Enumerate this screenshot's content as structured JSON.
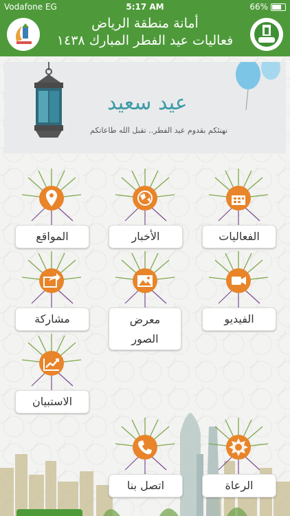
{
  "status_bar": {
    "carrier": "Vodafone EG",
    "time": "5:17 AM",
    "battery": "66%"
  },
  "header": {
    "line1": "أمانة منطقة الرياض",
    "line2": "فعاليات عيد الفطر المبارك ١٤٣٨"
  },
  "banner": {
    "title": "عيد سعيد",
    "subtitle": "نهنئكم بقدوم عيد الفطر.. تقبل الله طاعاتكم"
  },
  "tiles": {
    "events": "الفعاليات",
    "news": "الأخبار",
    "locations": "المواقع",
    "video": "الفيديو",
    "gallery_line1": "معرض",
    "gallery_line2": "الصور",
    "share": "مشاركة",
    "survey": "الاستبيان",
    "sponsors": "الرعاة",
    "contact": "اتصل بنا"
  },
  "colors": {
    "header_green": "#4e9a3a",
    "icon_orange": "#e8842a"
  }
}
